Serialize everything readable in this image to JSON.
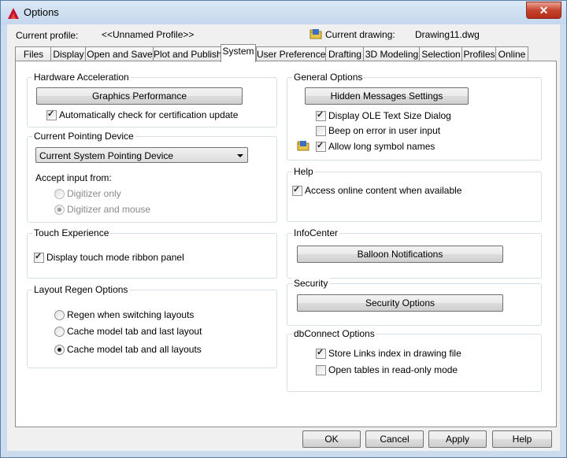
{
  "window": {
    "title": "Options",
    "close_glyph": "✕"
  },
  "header": {
    "current_profile_label": "Current profile:",
    "current_profile_value": "<<Unnamed Profile>>",
    "current_drawing_label": "Current drawing:",
    "current_drawing_value": "Drawing11.dwg"
  },
  "tabs": [
    "Files",
    "Display",
    "Open and Save",
    "Plot and Publish",
    "System",
    "User Preferences",
    "Drafting",
    "3D Modeling",
    "Selection",
    "Profiles",
    "Online"
  ],
  "active_tab": "System",
  "hardware": {
    "title": "Hardware Acceleration",
    "graphics_button": "Graphics Performance",
    "auto_check_label": "Automatically check for certification update",
    "auto_check_checked": true
  },
  "pointing": {
    "title": "Current Pointing Device",
    "device_value": "Current System Pointing Device",
    "accept_label": "Accept input from:",
    "digitizer_only": "Digitizer only",
    "digitizer_mouse": "Digitizer and mouse",
    "selected": "Digitizer and mouse"
  },
  "touch": {
    "title": "Touch Experience",
    "ribbon_label": "Display touch mode ribbon panel",
    "ribbon_checked": true
  },
  "layout_regen": {
    "title": "Layout Regen Options",
    "option1": "Regen when switching layouts",
    "option2": "Cache model tab and last layout",
    "option3": "Cache model tab and all layouts",
    "selected": "Cache model tab and all layouts"
  },
  "general": {
    "title": "General Options",
    "hidden_messages_button": "Hidden Messages Settings",
    "ole_label": "Display OLE Text Size Dialog",
    "ole_checked": true,
    "beep_label": "Beep on error in user input",
    "beep_checked": false,
    "long_names_label": "Allow long symbol names",
    "long_names_checked": true
  },
  "help": {
    "title": "Help",
    "online_label": "Access online content when available",
    "online_checked": true
  },
  "infocenter": {
    "title": "InfoCenter",
    "balloon_button": "Balloon Notifications"
  },
  "security": {
    "title": "Security",
    "security_button": "Security Options"
  },
  "dbconnect": {
    "title": "dbConnect Options",
    "store_links_label": "Store Links index in drawing file",
    "store_links_checked": true,
    "readonly_label": "Open tables in read-only mode",
    "readonly_checked": false
  },
  "footer": {
    "ok": "OK",
    "cancel": "Cancel",
    "apply": "Apply",
    "help": "Help"
  },
  "colors": {
    "accent": "#c7452f",
    "frame": "#cbdcef"
  }
}
